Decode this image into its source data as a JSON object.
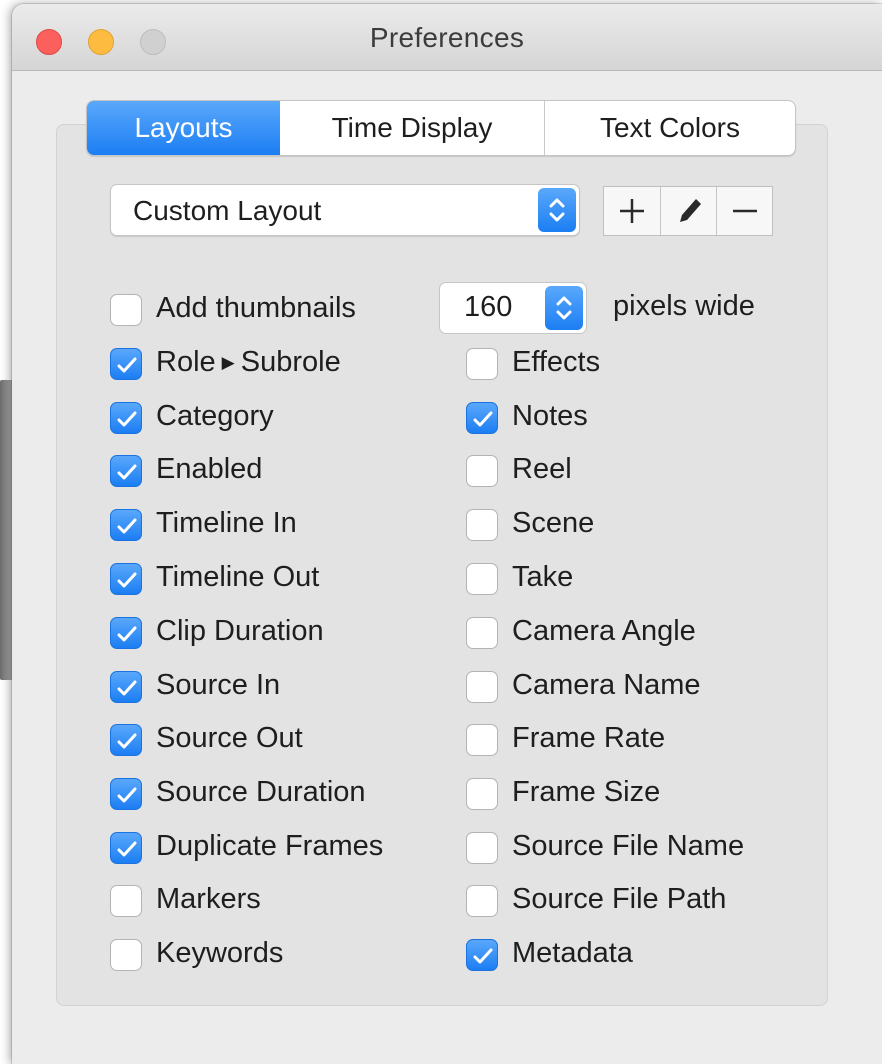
{
  "window": {
    "title": "Preferences"
  },
  "tabs": [
    {
      "label": "Layouts",
      "selected": true
    },
    {
      "label": "Time Display",
      "selected": false
    },
    {
      "label": "Text Colors",
      "selected": false
    }
  ],
  "layout_select": {
    "value": "Custom Layout"
  },
  "layout_actions": {
    "add_icon": "plus-icon",
    "edit_icon": "pencil-icon",
    "remove_icon": "minus-icon"
  },
  "thumbnails": {
    "label": "Add thumbnails",
    "checked": false,
    "width_value": "160",
    "unit_label": "pixels wide"
  },
  "columns_left": [
    {
      "label_main": "Role",
      "label_sub": "Subrole",
      "checked": true
    },
    {
      "label": "Category",
      "checked": true
    },
    {
      "label": "Enabled",
      "checked": true
    },
    {
      "label": "Timeline In",
      "checked": true
    },
    {
      "label": "Timeline Out",
      "checked": true
    },
    {
      "label": "Clip Duration",
      "checked": true
    },
    {
      "label": "Source In",
      "checked": true
    },
    {
      "label": "Source Out",
      "checked": true
    },
    {
      "label": "Source Duration",
      "checked": true
    },
    {
      "label": "Duplicate Frames",
      "checked": true
    },
    {
      "label": "Markers",
      "checked": false
    },
    {
      "label": "Keywords",
      "checked": false
    }
  ],
  "columns_right": [
    {
      "label": "Effects",
      "checked": false
    },
    {
      "label": "Notes",
      "checked": true
    },
    {
      "label": "Reel",
      "checked": false
    },
    {
      "label": "Scene",
      "checked": false
    },
    {
      "label": "Take",
      "checked": false
    },
    {
      "label": "Camera Angle",
      "checked": false
    },
    {
      "label": "Camera Name",
      "checked": false
    },
    {
      "label": "Frame Rate",
      "checked": false
    },
    {
      "label": "Frame Size",
      "checked": false
    },
    {
      "label": "Source File Name",
      "checked": false
    },
    {
      "label": "Source File Path",
      "checked": false
    },
    {
      "label": "Metadata",
      "checked": true
    }
  ],
  "colors": {
    "accent": "#1c7ef3",
    "close": "#fc605c",
    "minimize": "#fdbc40",
    "zoom_disabled": "#d0d0d0"
  }
}
